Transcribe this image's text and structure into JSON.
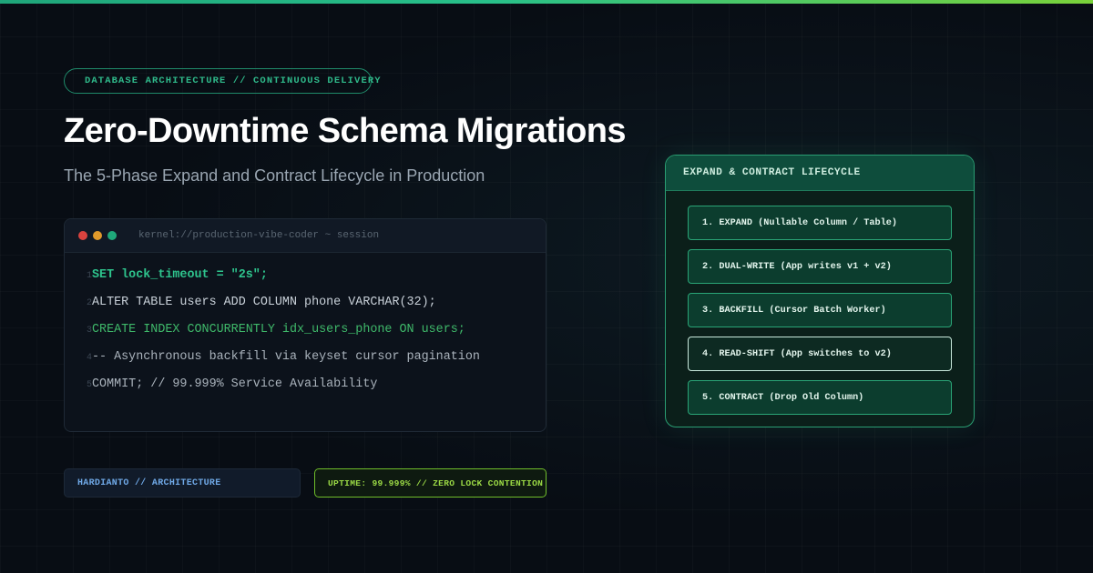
{
  "badge": {
    "text": "DATABASE ARCHITECTURE // CONTINUOUS DELIVERY"
  },
  "title": "Zero-Downtime Schema Migrations",
  "subtitle": "The 5-Phase Expand and Contract Lifecycle in Production",
  "terminal": {
    "title": "kernel://production-vibe-coder ~ session",
    "lines": [
      {
        "num": "1",
        "text": "SET lock_timeout = \"2s\";"
      },
      {
        "num": "2",
        "text": "ALTER TABLE users ADD COLUMN phone VARCHAR(32);"
      },
      {
        "num": "3",
        "text": "CREATE INDEX CONCURRENTLY idx_users_phone ON users;"
      },
      {
        "num": "4",
        "text": "-- Asynchronous backfill via keyset cursor pagination"
      },
      {
        "num": "5",
        "text": "COMMIT; // 99.999% Service Availability"
      }
    ]
  },
  "footer": {
    "author": "HARDIANTO // ARCHITECTURE",
    "uptime": "UPTIME: 99.999% // ZERO LOCK CONTENTION"
  },
  "lifecycle": {
    "title": "EXPAND & CONTRACT LIFECYCLE",
    "phases": [
      {
        "label": "1. EXPAND (Nullable Column / Table)"
      },
      {
        "label": "2. DUAL-WRITE (App writes v1 + v2)"
      },
      {
        "label": "3. BACKFILL (Cursor Batch Worker)"
      },
      {
        "label": "4. READ-SHIFT (App switches to v2)"
      },
      {
        "label": "5. CONTRACT (Drop Old Column)"
      }
    ]
  },
  "colors": {
    "background": "#080d14",
    "accent_green": "#2fb98a",
    "lime": "#8fd629",
    "blue": "#6fa8e6"
  }
}
